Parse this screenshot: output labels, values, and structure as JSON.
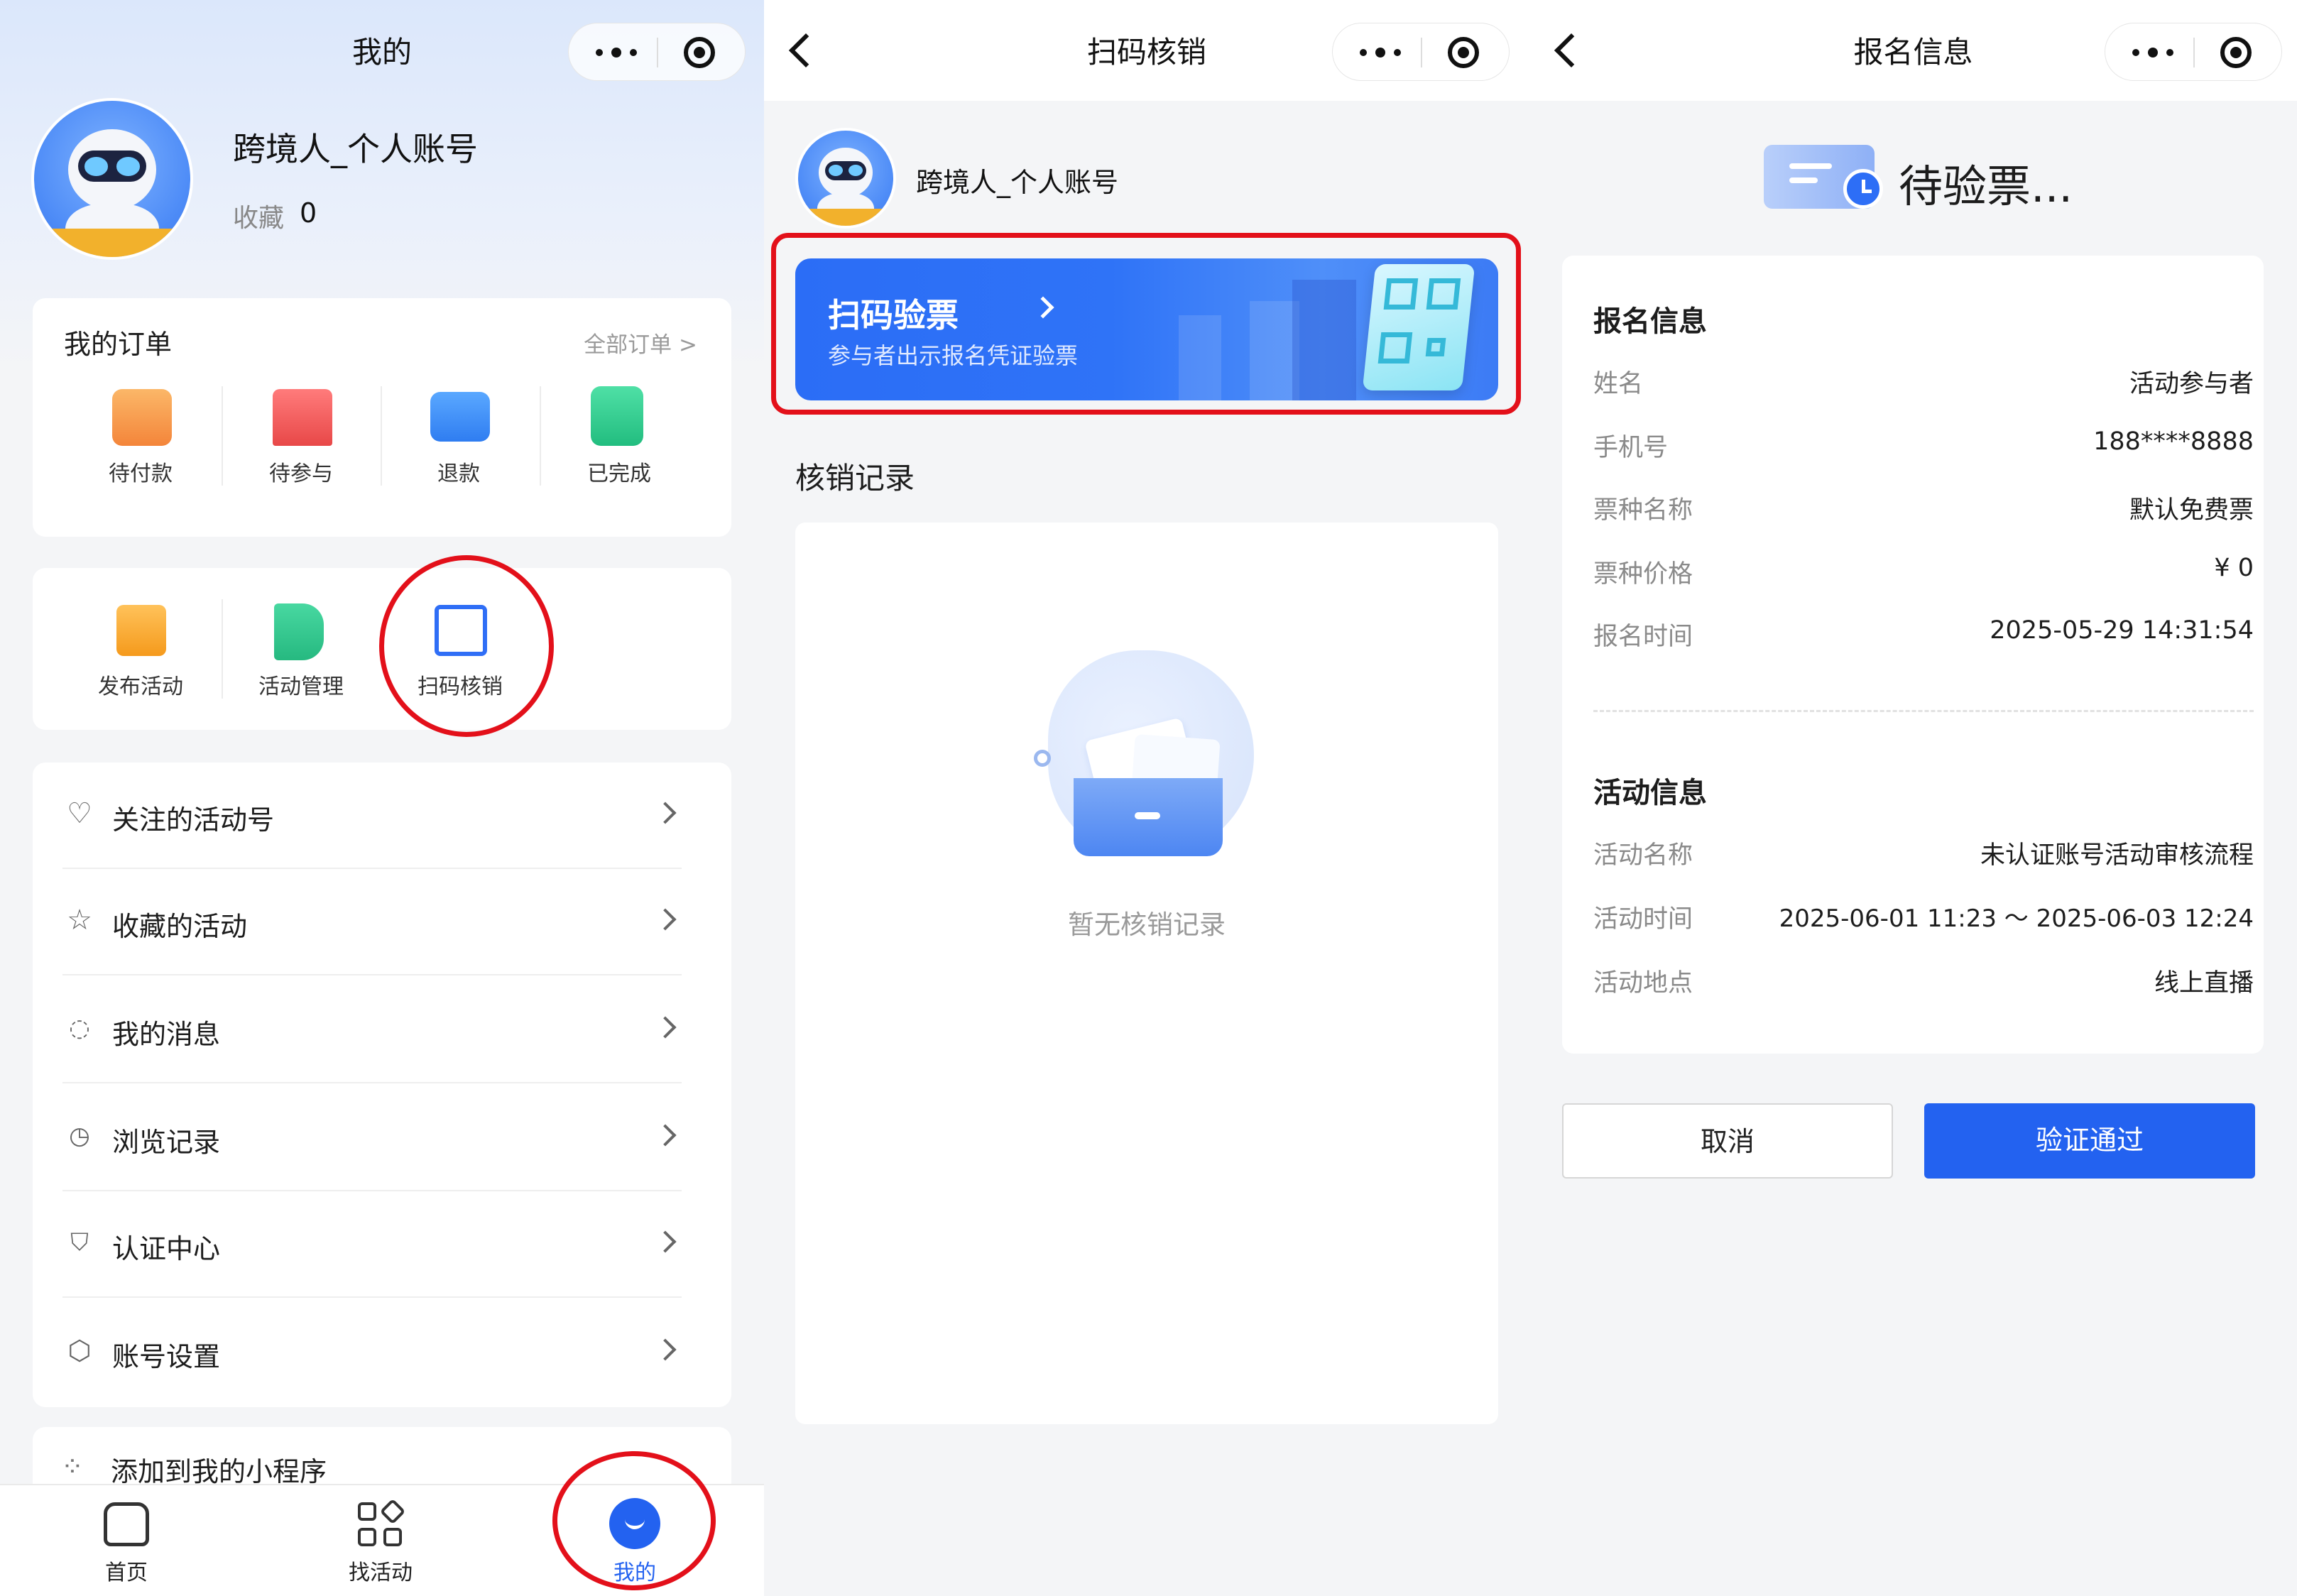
{
  "left": {
    "nav_title": "我的",
    "profile": {
      "name": "跨境人_个人账号",
      "fav_label": "收藏",
      "fav_count": "0"
    },
    "orders": {
      "title": "我的订单",
      "all_link": "全部订单 >",
      "items": [
        {
          "label": "待付款",
          "icon": "wallet-icon",
          "color": "#f4933c"
        },
        {
          "label": "待参与",
          "icon": "bookmark-star-icon",
          "color": "#ef4d4d"
        },
        {
          "label": "退款",
          "icon": "refund-card-icon",
          "color": "#2f85f5"
        },
        {
          "label": "已完成",
          "icon": "clipboard-check-icon",
          "color": "#2ec98b"
        }
      ]
    },
    "tools": [
      {
        "label": "发布活动",
        "icon": "calendar-plus-icon",
        "color": "#f5a623"
      },
      {
        "label": "活动管理",
        "icon": "flag-gear-icon",
        "color": "#35c48f"
      },
      {
        "label": "扫码核销",
        "icon": "scan-icon",
        "color": "#2f6ef6"
      }
    ],
    "menu": [
      {
        "label": "关注的活动号",
        "icon": "heart-icon"
      },
      {
        "label": "收藏的活动",
        "icon": "star-icon"
      },
      {
        "label": "我的消息",
        "icon": "chat-icon"
      },
      {
        "label": "浏览记录",
        "icon": "clock-icon"
      },
      {
        "label": "认证中心",
        "icon": "shield-icon"
      },
      {
        "label": "账号设置",
        "icon": "settings-icon"
      }
    ],
    "add_program": "添加到我的小程序",
    "tabs": [
      {
        "label": "首页",
        "icon": "home-icon"
      },
      {
        "label": "找活动",
        "icon": "grid-icon"
      },
      {
        "label": "我的",
        "icon": "smile-icon"
      }
    ]
  },
  "mid": {
    "nav_title": "扫码核销",
    "profile_name": "跨境人_个人账号",
    "banner": {
      "title": "扫码验票",
      "subtitle": "参与者出示报名凭证验票"
    },
    "records_title": "核销记录",
    "empty_text": "暂无核销记录"
  },
  "right": {
    "nav_title": "报名信息",
    "status": "待验票...",
    "registration": {
      "title": "报名信息",
      "rows": [
        {
          "key": "姓名",
          "value": "活动参与者"
        },
        {
          "key": "手机号",
          "value": "188****8888"
        },
        {
          "key": "票种名称",
          "value": "默认免费票"
        },
        {
          "key": "票种价格",
          "value": "¥ 0"
        },
        {
          "key": "报名时间",
          "value": "2025-05-29 14:31:54"
        }
      ]
    },
    "activity": {
      "title": "活动信息",
      "rows": [
        {
          "key": "活动名称",
          "value": "未认证账号活动审核流程"
        },
        {
          "key": "活动时间",
          "value": "2025-06-01 11:23 ～ 2025-06-03 12:24"
        },
        {
          "key": "活动地点",
          "value": "线上直播"
        }
      ]
    },
    "cancel": "取消",
    "confirm": "验证通过"
  },
  "colors": {
    "accent": "#2362f0",
    "highlight": "#e3101a"
  }
}
